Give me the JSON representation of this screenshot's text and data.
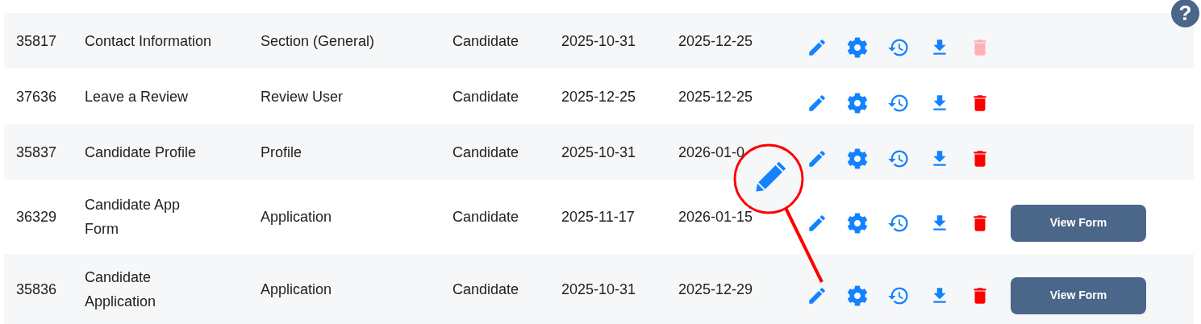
{
  "rows": [
    {
      "id": "35817",
      "name": "Contact Information",
      "type": "Section (General)",
      "role": "Candidate",
      "date_1": "2025-10-31",
      "date_2": "2025-12-25",
      "delete_disabled": true
    },
    {
      "id": "37636",
      "name": "Leave a Review",
      "type": "Review User",
      "role": "Candidate",
      "date_1": "2025-12-25",
      "date_2": "2025-12-25",
      "delete_disabled": false
    },
    {
      "id": "35837",
      "name": "Candidate Profile",
      "type": "Profile",
      "role": "Candidate",
      "date_1": "2025-10-31",
      "date_2": "2026-01-0",
      "delete_disabled": false
    },
    {
      "id": "36329",
      "name": "Candidate App Form",
      "type": "Application",
      "role": "Candidate",
      "date_1": "2025-11-17",
      "date_2": "2026-01-15",
      "delete_disabled": false,
      "button": "View Form"
    },
    {
      "id": "35836",
      "name": "Candidate Application",
      "type": "Application",
      "role": "Candidate",
      "date_1": "2025-10-31",
      "date_2": "2025-12-29",
      "delete_disabled": false,
      "button": "View Form"
    }
  ],
  "help": {
    "label": "?"
  }
}
